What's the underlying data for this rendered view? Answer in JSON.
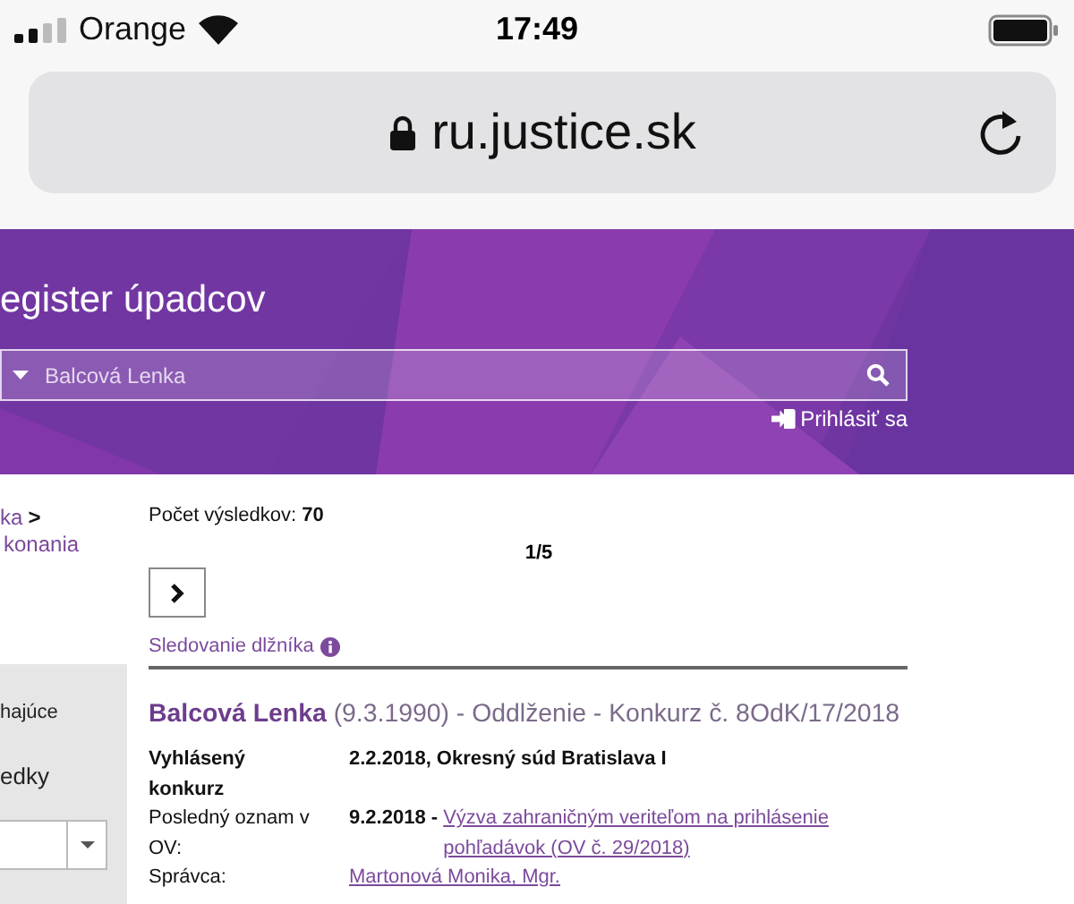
{
  "status_bar": {
    "carrier": "Orange",
    "time": "17:49"
  },
  "address_bar": {
    "url": "ru.justice.sk"
  },
  "header": {
    "title": "egister úpadcov",
    "search": {
      "placeholder": "Balcová Lenka"
    },
    "login": "Prihlásiť sa"
  },
  "sidebar": {
    "breadcrumb": [
      {
        "text": "ka",
        "kind": "link"
      },
      {
        "text": ">",
        "kind": "separator"
      }
    ],
    "link": "konania",
    "panel_items": [
      "hajúce",
      "edky"
    ]
  },
  "results": {
    "count_label": "Počet výsledkov:",
    "count": "70",
    "page": "1/5",
    "tracking": "Sledovanie dlžníka",
    "items": [
      {
        "name": "Balcová Lenka",
        "details": "(9.3.1990) - Oddlženie - Konkurz č. 8OdK/17/2018",
        "fields": [
          {
            "label": "Vyhlásený konkurz",
            "value": "2.2.2018, Okresný súd Bratislava I"
          },
          {
            "label": "Posledný oznam v OV:",
            "value": "9.2.2018 - ",
            "link": "Výzva zahraničným veriteľom na prihlásenie pohľadávok (OV č. 29/2018)"
          },
          {
            "label": "Správca:",
            "link": "Martonová Monika, Mgr."
          }
        ]
      }
    ]
  }
}
